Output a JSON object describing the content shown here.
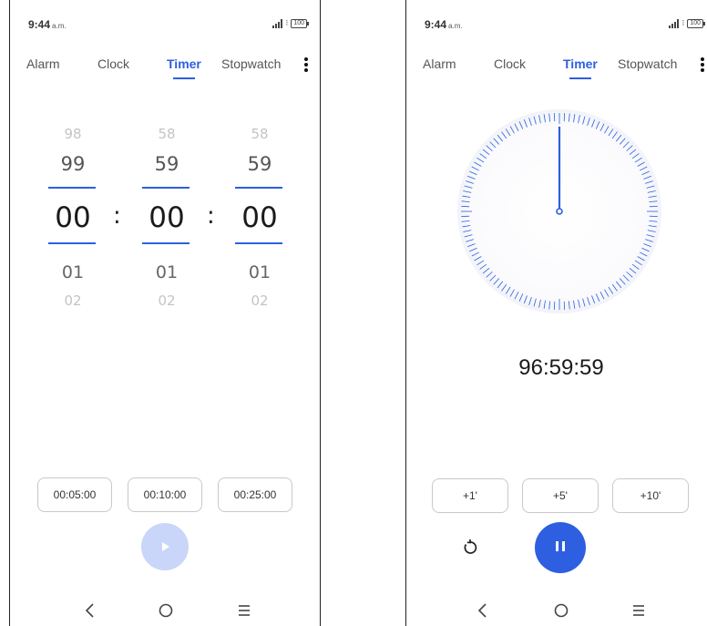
{
  "screens": [
    {
      "status": {
        "time": "9:44",
        "ampm": "a.m.",
        "battery": "100"
      },
      "tabs": [
        "Alarm",
        "Clock",
        "Timer",
        "Stopwatch"
      ],
      "active_tab": "Timer",
      "picker": {
        "hours": {
          "far_above": "98",
          "above": "99",
          "selected": "00",
          "below": "01",
          "far_below": "02"
        },
        "minutes": {
          "far_above": "58",
          "above": "59",
          "selected": "00",
          "below": "01",
          "far_below": "02"
        },
        "seconds": {
          "far_above": "58",
          "above": "59",
          "selected": "00",
          "below": "01",
          "far_below": "02"
        },
        "separator": ":"
      },
      "presets": [
        "00:05:00",
        "00:10:00",
        "00:25:00"
      ],
      "start_button": {
        "icon": "play-icon",
        "enabled": false
      }
    },
    {
      "status": {
        "time": "9:44",
        "ampm": "a.m.",
        "battery": "100"
      },
      "tabs": [
        "Alarm",
        "Clock",
        "Timer",
        "Stopwatch"
      ],
      "active_tab": "Timer",
      "remaining": "96:59:59",
      "add_buttons": [
        "+1'",
        "+5'",
        "+10'"
      ],
      "reset_icon": "reset-icon",
      "pause_icon": "pause-icon"
    }
  ],
  "nav": {
    "back_icon": "back-icon",
    "home_icon": "home-icon",
    "menu_icon": "menu-icon"
  },
  "colors": {
    "accent": "#2d5fe0",
    "accent_disabled": "#c9d6fa",
    "text": "#1a1a1a"
  }
}
